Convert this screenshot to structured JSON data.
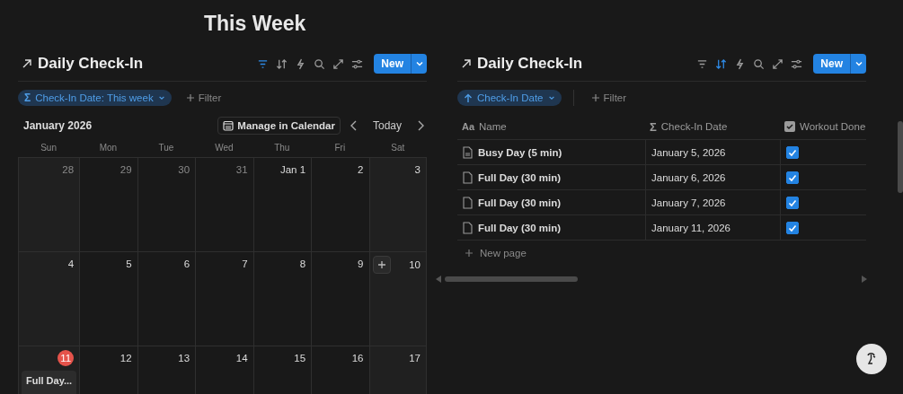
{
  "page_title": "This Week",
  "calendar_panel": {
    "title": "Daily Check-In",
    "tools": [
      {
        "kind": "filter",
        "active": true
      },
      {
        "kind": "sort",
        "active": false
      },
      {
        "kind": "bolt",
        "active": false
      },
      {
        "kind": "search",
        "active": false
      },
      {
        "kind": "expand",
        "active": false
      },
      {
        "kind": "settings",
        "active": false
      }
    ],
    "new_button": "New",
    "chip": {
      "kind": "sigma",
      "icon": "Σ",
      "label": "Check-In Date: This week"
    },
    "add_filter": "Filter",
    "month": "January 2026",
    "manage_button": "Manage in Calendar",
    "today_button": "Today",
    "weekdays": [
      "Sun",
      "Mon",
      "Tue",
      "Wed",
      "Thu",
      "Fri",
      "Sat"
    ],
    "weeks": [
      [
        {
          "label": "28",
          "muted": true
        },
        {
          "label": "29",
          "muted": true
        },
        {
          "label": "30",
          "muted": true
        },
        {
          "label": "31",
          "muted": true
        },
        {
          "label": "Jan 1",
          "muted": false
        },
        {
          "label": "2",
          "muted": false
        },
        {
          "label": "3",
          "muted": false
        }
      ],
      [
        {
          "label": "4",
          "muted": false
        },
        {
          "label": "5",
          "muted": false
        },
        {
          "label": "6",
          "muted": false
        },
        {
          "label": "7",
          "muted": false
        },
        {
          "label": "8",
          "muted": false
        },
        {
          "label": "9",
          "muted": false
        },
        {
          "label": "10",
          "muted": false,
          "add_button": true
        }
      ],
      [
        {
          "label": "11",
          "muted": false,
          "today": true,
          "events": [
            "Full Day..."
          ]
        },
        {
          "label": "12",
          "muted": false
        },
        {
          "label": "13",
          "muted": false
        },
        {
          "label": "14",
          "muted": false
        },
        {
          "label": "15",
          "muted": false
        },
        {
          "label": "16",
          "muted": false
        },
        {
          "label": "17",
          "muted": false
        }
      ]
    ]
  },
  "table_panel": {
    "title": "Daily Check-In",
    "tools": [
      {
        "kind": "filter",
        "active": false
      },
      {
        "kind": "sort",
        "active": true
      },
      {
        "kind": "bolt",
        "active": false
      },
      {
        "kind": "search",
        "active": false
      },
      {
        "kind": "expand",
        "active": false
      },
      {
        "kind": "settings",
        "active": false
      }
    ],
    "new_button": "New",
    "chip": {
      "kind": "arrow",
      "label": "Check-In Date"
    },
    "add_filter": "Filter",
    "columns": [
      {
        "kind": "text",
        "icon": "Aa",
        "label": "Name"
      },
      {
        "kind": "sigma",
        "icon": "Σ",
        "label": "Check-In Date"
      },
      {
        "kind": "checkbox",
        "label": "Workout Done"
      }
    ],
    "rows": [
      {
        "kind": "note",
        "name": "Busy Day (5 min)",
        "date": "January 5, 2026",
        "checked": true
      },
      {
        "kind": "page",
        "name": "Full Day (30 min)",
        "date": "January 6, 2026",
        "checked": true
      },
      {
        "kind": "page",
        "name": "Full Day (30 min)",
        "date": "January 7, 2026",
        "checked": true
      },
      {
        "kind": "page",
        "name": "Full Day (30 min)",
        "date": "January 11, 2026",
        "checked": true
      }
    ],
    "new_page": "New page"
  }
}
